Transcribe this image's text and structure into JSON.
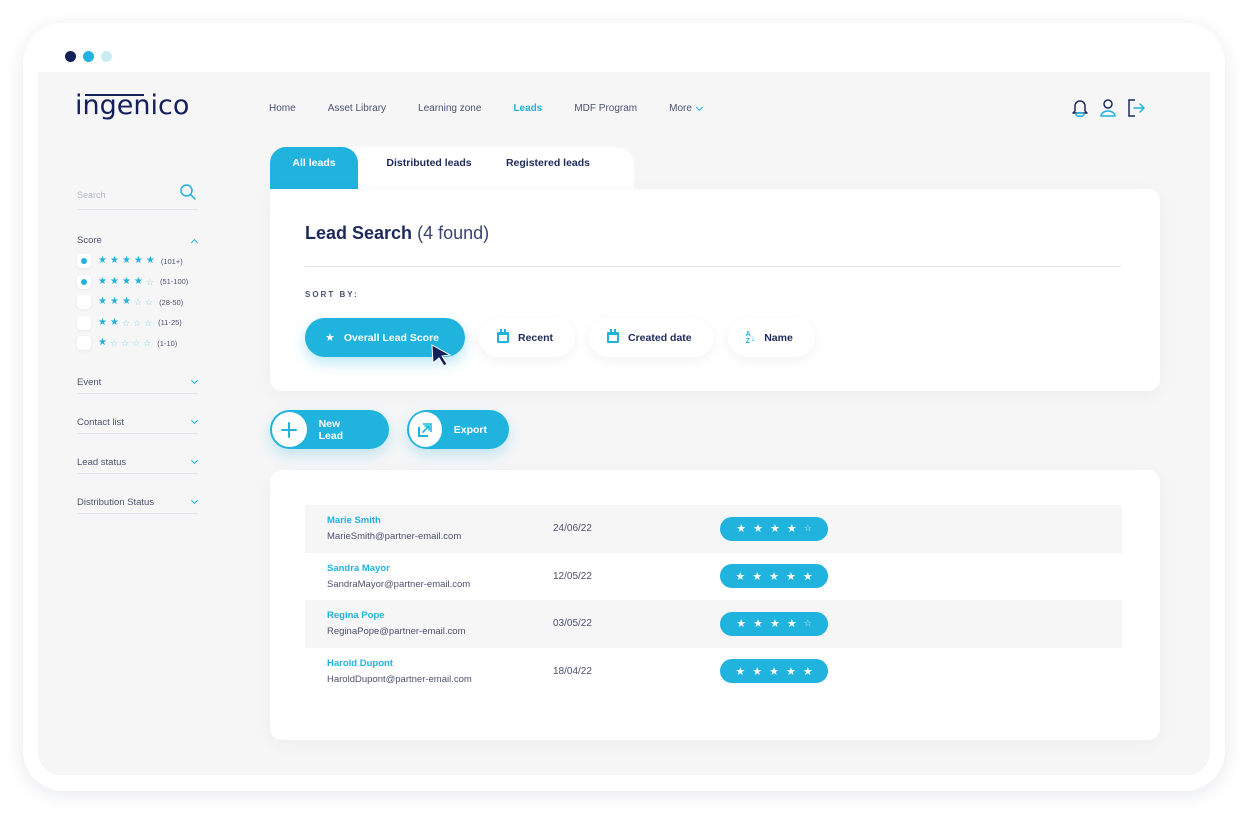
{
  "window": {
    "dots": [
      "#13205a",
      "#1fb3de",
      "#c9edf3"
    ]
  },
  "brand": {
    "logo": "ingenico",
    "accent": "#1fb3de",
    "navy": "#13205a"
  },
  "nav": {
    "items": [
      {
        "label": "Home",
        "active": false
      },
      {
        "label": "Asset Library",
        "active": false
      },
      {
        "label": "Learning zone",
        "active": false
      },
      {
        "label": "Leads",
        "active": true
      },
      {
        "label": "MDF Program",
        "active": false
      }
    ],
    "more_label": "More",
    "icons": [
      "bell-icon",
      "user-icon",
      "logout-icon"
    ]
  },
  "sidebar": {
    "search_placeholder": "Search",
    "score": {
      "label": "Score",
      "expanded": true,
      "options": [
        {
          "stars": 5,
          "range": "(101+)",
          "checked": true
        },
        {
          "stars": 4,
          "range": "(51-100)",
          "checked": true
        },
        {
          "stars": 3,
          "range": "(28-50)",
          "checked": false
        },
        {
          "stars": 2,
          "range": "(11-25)",
          "checked": false
        },
        {
          "stars": 1,
          "range": "(1-10)",
          "checked": false
        }
      ]
    },
    "filters": [
      {
        "label": "Event"
      },
      {
        "label": "Contact list"
      },
      {
        "label": "Lead status"
      },
      {
        "label": "Distribution Status"
      }
    ]
  },
  "tabs": [
    {
      "label": "All leads",
      "active": true
    },
    {
      "label": "Distributed leads",
      "active": false
    },
    {
      "label": "Registered leads",
      "active": false
    }
  ],
  "search_card": {
    "title": "Lead Search",
    "count_text": "(4 found)",
    "sort_label": "SORT BY:",
    "sort_options": [
      {
        "label": "Overall Lead Score",
        "icon": "star-icon",
        "active": true
      },
      {
        "label": "Recent",
        "icon": "calendar-icon",
        "active": false
      },
      {
        "label": "Created date",
        "icon": "calendar-icon",
        "active": false
      },
      {
        "label": "Name",
        "icon": "sort-az-icon",
        "active": false
      }
    ]
  },
  "actions": {
    "new_lead": "New Lead",
    "export": "Export"
  },
  "leads": [
    {
      "name": "Marie Smith",
      "email": "MarieSmith@partner-email.com",
      "date": "24/06/22",
      "stars": 4
    },
    {
      "name": "Sandra Mayor",
      "email": "SandraMayor@partner-email.com",
      "date": "12/05/22",
      "stars": 5
    },
    {
      "name": "Regina Pope",
      "email": "ReginaPope@partner-email.com",
      "date": "03/05/22",
      "stars": 4
    },
    {
      "name": "Harold Dupont",
      "email": "HaroldDupont@partner-email.com",
      "date": "18/04/22",
      "stars": 5
    }
  ]
}
